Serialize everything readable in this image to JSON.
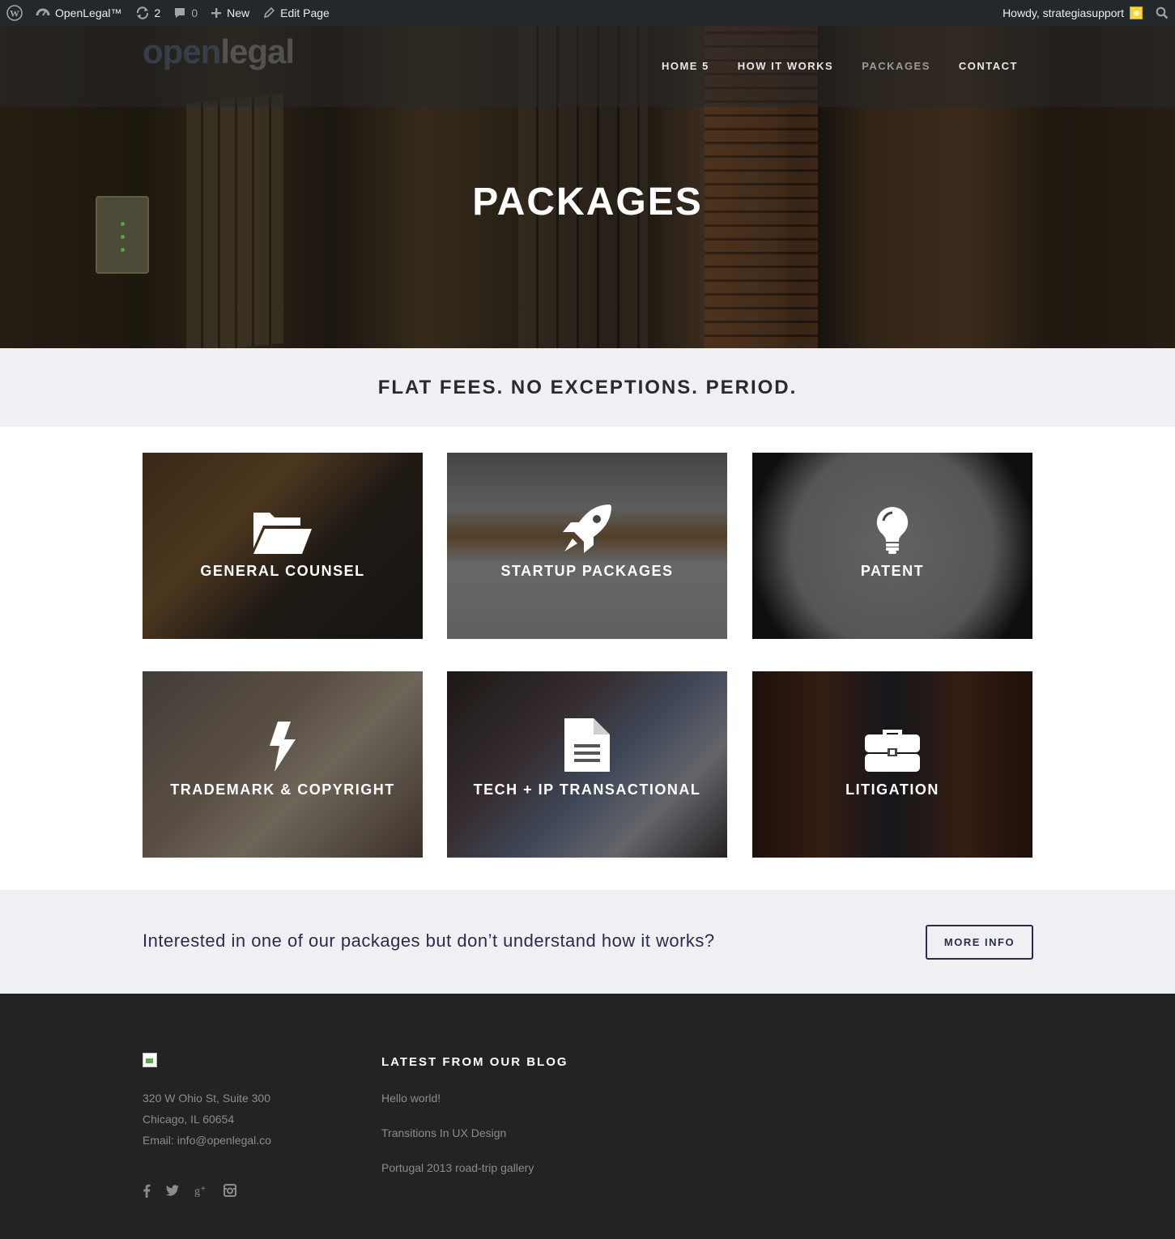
{
  "admin_bar": {
    "site_name": "OpenLegal™",
    "updates_count": "2",
    "comments_count": "0",
    "new_label": "New",
    "edit_label": "Edit Page",
    "greeting": "Howdy, strategiasupport"
  },
  "header": {
    "logo_text_a": "open",
    "logo_text_b": "legal",
    "nav": [
      {
        "label": "HOME 5",
        "active": false
      },
      {
        "label": "HOW IT WORKS",
        "active": false
      },
      {
        "label": "PACKAGES",
        "active": true
      },
      {
        "label": "CONTACT",
        "active": false
      }
    ]
  },
  "hero": {
    "title": "PACKAGES"
  },
  "tagline": "FLAT FEES. NO EXCEPTIONS. PERIOD.",
  "packages": [
    {
      "label": "GENERAL COUNSEL",
      "icon": "folder-open-icon"
    },
    {
      "label": "STARTUP PACKAGES",
      "icon": "rocket-icon"
    },
    {
      "label": "PATENT",
      "icon": "lightbulb-icon"
    },
    {
      "label": "TRADEMARK & COPYRIGHT",
      "icon": "lightning-bolt-icon"
    },
    {
      "label": "TECH + IP TRANSACTIONAL",
      "icon": "document-icon"
    },
    {
      "label": "LITIGATION",
      "icon": "briefcase-icon"
    }
  ],
  "cta": {
    "text": "Interested in one of our packages but don’t understand how it works?",
    "button_label": "MORE INFO"
  },
  "footer": {
    "address_line1": "320 W Ohio St, Suite 300",
    "address_line2": "Chicago, IL 60654",
    "email": "Email: info@openlegal.co",
    "blog_heading": "LATEST FROM OUR BLOG",
    "blog_posts": [
      "Hello world!",
      "Transitions In UX Design",
      "Portugal 2013 road-trip gallery"
    ],
    "social_icons": [
      "facebook-icon",
      "twitter-icon",
      "google-plus-icon",
      "instagram-icon"
    ]
  },
  "colors": {
    "admin_bar_bg": "#23282d",
    "band_bg": "#eef0f4",
    "footer_bg": "#232323",
    "cta_text": "#2d2b4a",
    "nav_active": "#9a9a9a"
  }
}
